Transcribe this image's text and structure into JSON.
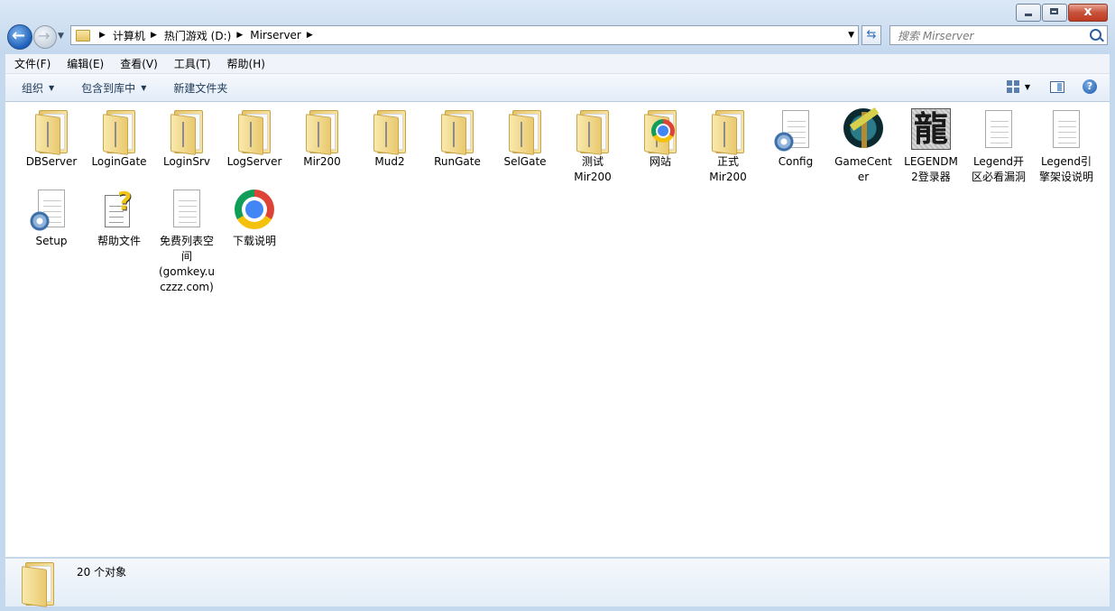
{
  "window": {
    "minimize_label": "",
    "maximize_label": "",
    "close_label": "x"
  },
  "address": {
    "crumbs": [
      "计算机",
      "热门游戏 (D:)",
      "Mirserver"
    ]
  },
  "search": {
    "placeholder": "搜索 Mirserver"
  },
  "menubar": [
    "文件(F)",
    "编辑(E)",
    "查看(V)",
    "工具(T)",
    "帮助(H)"
  ],
  "toolbar": {
    "organize": "组织",
    "include_library": "包含到库中",
    "new_folder": "新建文件夹"
  },
  "icons": {
    "back": "back-arrow-icon",
    "forward": "forward-arrow-icon",
    "refresh": "refresh-icon",
    "search": "search-icon",
    "help": "help-icon",
    "view": "view-options-icon",
    "preview_pane": "preview-pane-icon"
  },
  "files": [
    {
      "name": "DBServer",
      "kind": "folder"
    },
    {
      "name": "LoginGate",
      "kind": "folder"
    },
    {
      "name": "LoginSrv",
      "kind": "folder"
    },
    {
      "name": "LogServer",
      "kind": "folder"
    },
    {
      "name": "Mir200",
      "kind": "folder"
    },
    {
      "name": "Mud2",
      "kind": "folder"
    },
    {
      "name": "RunGate",
      "kind": "folder"
    },
    {
      "name": "SelGate",
      "kind": "folder"
    },
    {
      "name": "测试\nMir200",
      "kind": "folder"
    },
    {
      "name": "网站",
      "kind": "chrome-folder"
    },
    {
      "name": "正式\nMir200",
      "kind": "folder"
    },
    {
      "name": "Config",
      "kind": "config"
    },
    {
      "name": "GameCent\ner",
      "kind": "gamecenter"
    },
    {
      "name": "LEGENDM\n2登录器",
      "kind": "dragon"
    },
    {
      "name": "Legend开\n区必看漏洞",
      "kind": "doc"
    },
    {
      "name": "Legend引\n擎架设说明",
      "kind": "doc"
    },
    {
      "name": "Setup",
      "kind": "config"
    },
    {
      "name": "帮助文件",
      "kind": "helpfile"
    },
    {
      "name": "免费列表空\n间\n(gomkey.u\nczzz.com)",
      "kind": "doc"
    },
    {
      "name": "下载说明",
      "kind": "chrome"
    }
  ],
  "status": {
    "count_text": "20 个对象"
  }
}
